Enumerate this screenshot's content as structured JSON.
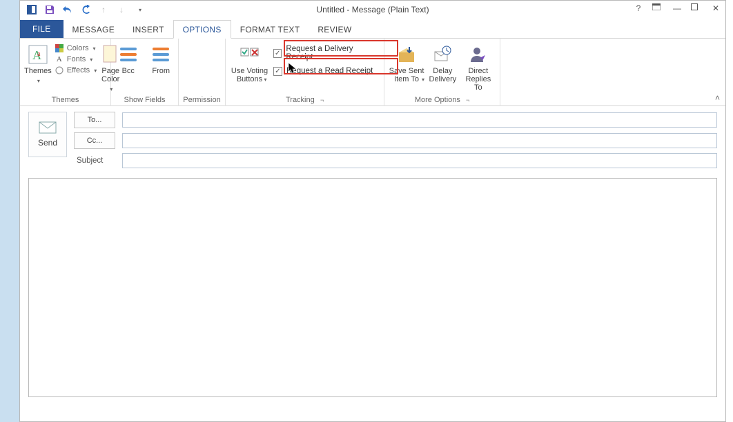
{
  "window": {
    "title": "Untitled - Message (Plain Text)"
  },
  "tabs": {
    "file": "FILE",
    "message": "MESSAGE",
    "insert": "INSERT",
    "options": "OPTIONS",
    "format_text": "FORMAT TEXT",
    "review": "REVIEW"
  },
  "ribbon": {
    "themes": {
      "label": "Themes",
      "themes_btn": "Themes",
      "colors": "Colors",
      "fonts": "Fonts",
      "effects": "Effects",
      "page_color": "Page\nColor"
    },
    "show_fields": {
      "label": "Show Fields",
      "bcc": "Bcc",
      "from": "From"
    },
    "permission": {
      "label": "Permission"
    },
    "tracking": {
      "label": "Tracking",
      "voting": "Use Voting\nButtons",
      "delivery_receipt": "Request a Delivery Receipt",
      "read_receipt": "Request a Read Receipt",
      "delivery_checked": true,
      "read_checked": true
    },
    "more_options": {
      "label": "More Options",
      "save_sent": "Save Sent\nItem To",
      "delay": "Delay\nDelivery",
      "direct": "Direct\nReplies To"
    }
  },
  "compose": {
    "send": "Send",
    "to_btn": "To...",
    "cc_btn": "Cc...",
    "subject_label": "Subject",
    "to_value": "",
    "cc_value": "",
    "subject_value": "",
    "body_value": ""
  }
}
